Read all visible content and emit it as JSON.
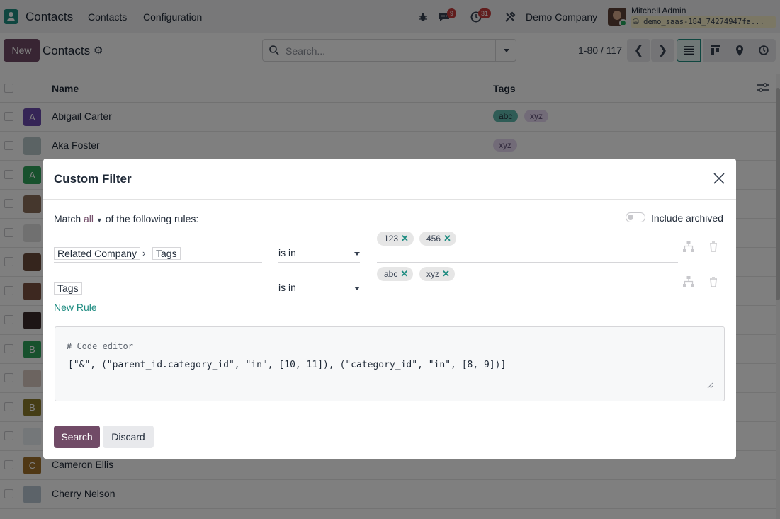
{
  "navbar": {
    "app_name": "Contacts",
    "menu": [
      "Contacts",
      "Configuration"
    ],
    "messages_count": "9",
    "activities_count": "31",
    "company": "Demo Company",
    "user_name": "Mitchell Admin",
    "db_name": "demo_saas-184_74274947fa..."
  },
  "control": {
    "new_label": "New",
    "breadcrumb": "Contacts",
    "search_placeholder": "Search...",
    "pager": "1-80 / 117"
  },
  "list": {
    "columns": {
      "name": "Name",
      "tags": "Tags"
    },
    "rows": [
      {
        "initial": "A",
        "name": "Abigail Carter",
        "color": "#6a4aad",
        "tags": [
          "abc",
          "xyz"
        ]
      },
      {
        "initial": "",
        "name": "Aka Foster",
        "color": "#b7c6c9",
        "tags": [
          "xyz"
        ]
      },
      {
        "initial": "A",
        "name": "",
        "color": "#2ea35a",
        "tags": []
      },
      {
        "initial": "",
        "name": "",
        "color": "#8a6f5a",
        "tags": []
      },
      {
        "initial": "",
        "name": "",
        "color": "#e0e0e0",
        "tags": []
      },
      {
        "initial": "",
        "name": "",
        "color": "#6b4b3a",
        "tags": []
      },
      {
        "initial": "",
        "name": "",
        "color": "#7a5040",
        "tags": []
      },
      {
        "initial": "",
        "name": "",
        "color": "#3a2a2a",
        "tags": []
      },
      {
        "initial": "B",
        "name": "",
        "color": "#2ea35a",
        "tags": []
      },
      {
        "initial": "",
        "name": "",
        "color": "#d8c8c0",
        "tags": []
      },
      {
        "initial": "B",
        "name": "",
        "color": "#8a7a2a",
        "tags": []
      },
      {
        "initial": "",
        "name": "",
        "color": "#e9eef2",
        "tags": []
      },
      {
        "initial": "C",
        "name": "Cameron Ellis",
        "color": "#a0712a",
        "tags": []
      },
      {
        "initial": "",
        "name": "Cherry Nelson",
        "color": "#b9c7d3",
        "tags": []
      }
    ]
  },
  "modal": {
    "title": "Custom Filter",
    "match_prefix": "Match",
    "match_value": "all",
    "match_suffix": "of the following rules:",
    "include_archived": "Include archived",
    "rules": [
      {
        "path": [
          "Related Company",
          "Tags"
        ],
        "operator": "is in",
        "values": [
          "123",
          "456"
        ]
      },
      {
        "path": [
          "Tags"
        ],
        "operator": "is in",
        "values": [
          "abc",
          "xyz"
        ]
      }
    ],
    "new_rule": "New Rule",
    "code_comment": "# Code editor",
    "code": "[\"&\", (\"parent_id.category_id\", \"in\", [10, 11]), (\"category_id\", \"in\", [8, 9])]",
    "search_label": "Search",
    "discard_label": "Discard"
  }
}
